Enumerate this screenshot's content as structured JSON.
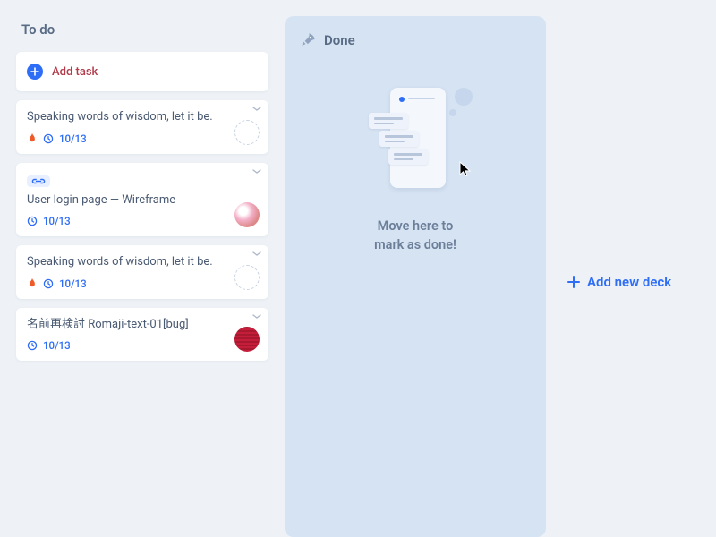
{
  "columns": {
    "todo": {
      "title": "To do",
      "add_task_label": "Add task",
      "cards": [
        {
          "title": "Speaking words of wisdom, let it be.",
          "date": "10/13",
          "priority": true,
          "avatar": "dashed"
        },
        {
          "link": true,
          "title": "User login page — Wireframe",
          "date": "10/13",
          "avatar": "photo"
        },
        {
          "title": "Speaking words of wisdom, let it be.",
          "date": "10/13",
          "priority": true,
          "avatar": "dashed"
        },
        {
          "title": "名前再検討 Romaji-text-01[bug]",
          "date": "10/13",
          "avatar": "red"
        }
      ]
    },
    "done": {
      "title": "Done",
      "empty_line1": "Move here to",
      "empty_line2": "mark as done!"
    }
  },
  "add_deck_label": "Add new deck",
  "colors": {
    "accent": "#2e6df6",
    "danger": "#c41e3a",
    "flame": "#f05a28"
  }
}
